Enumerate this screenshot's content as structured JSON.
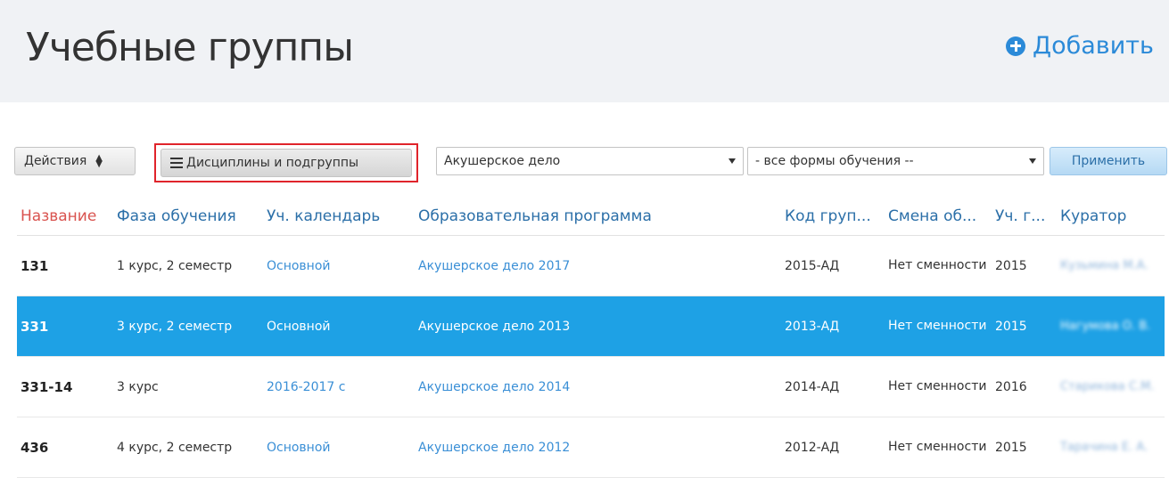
{
  "header": {
    "title": "Учебные группы",
    "add_label": "Добавить"
  },
  "toolbar": {
    "actions_label": "Действия",
    "disciplines_label": "Дисциплины и подгруппы",
    "program_select": "Акушерское дело",
    "form_select": "- все формы обучения --",
    "apply_label": "Применить"
  },
  "table": {
    "columns": [
      "Название",
      "Фаза обучения",
      "Уч. календарь",
      "Образовательная программа",
      "Код груп...",
      "Смена об...",
      "Уч. г...",
      "Куратор"
    ],
    "rows": [
      {
        "name": "131",
        "phase": "1 курс, 2 семестр",
        "calendar": "Основной",
        "program": "Акушерское дело 2017",
        "code": "2015-АД",
        "shift": "Нет сменности",
        "year": "2015",
        "curator": "Кузьмина М.А."
      },
      {
        "name": "331",
        "phase": "3 курс, 2 семестр",
        "calendar": "Основной",
        "program": "Акушерское дело 2013",
        "code": "2013-АД",
        "shift": "Нет сменности",
        "year": "2015",
        "curator": "Нагумова О. В."
      },
      {
        "name": "331-14",
        "phase": "3 курс",
        "calendar": "2016-2017 с",
        "program": "Акушерское дело 2014",
        "code": "2014-АД",
        "shift": "Нет сменности",
        "year": "2016",
        "curator": "Старикова С.М."
      },
      {
        "name": "436",
        "phase": "4 курс, 2 семестр",
        "calendar": "Основной",
        "program": "Акушерское дело 2012",
        "code": "2012-АД",
        "shift": "Нет сменности",
        "year": "2015",
        "curator": "Тарачина Е. А."
      }
    ]
  },
  "colors": {
    "accent": "#2b8ad8",
    "selected_row": "#1ea1e5",
    "active_sort": "#d9534f",
    "highlight": "#e0242b"
  }
}
